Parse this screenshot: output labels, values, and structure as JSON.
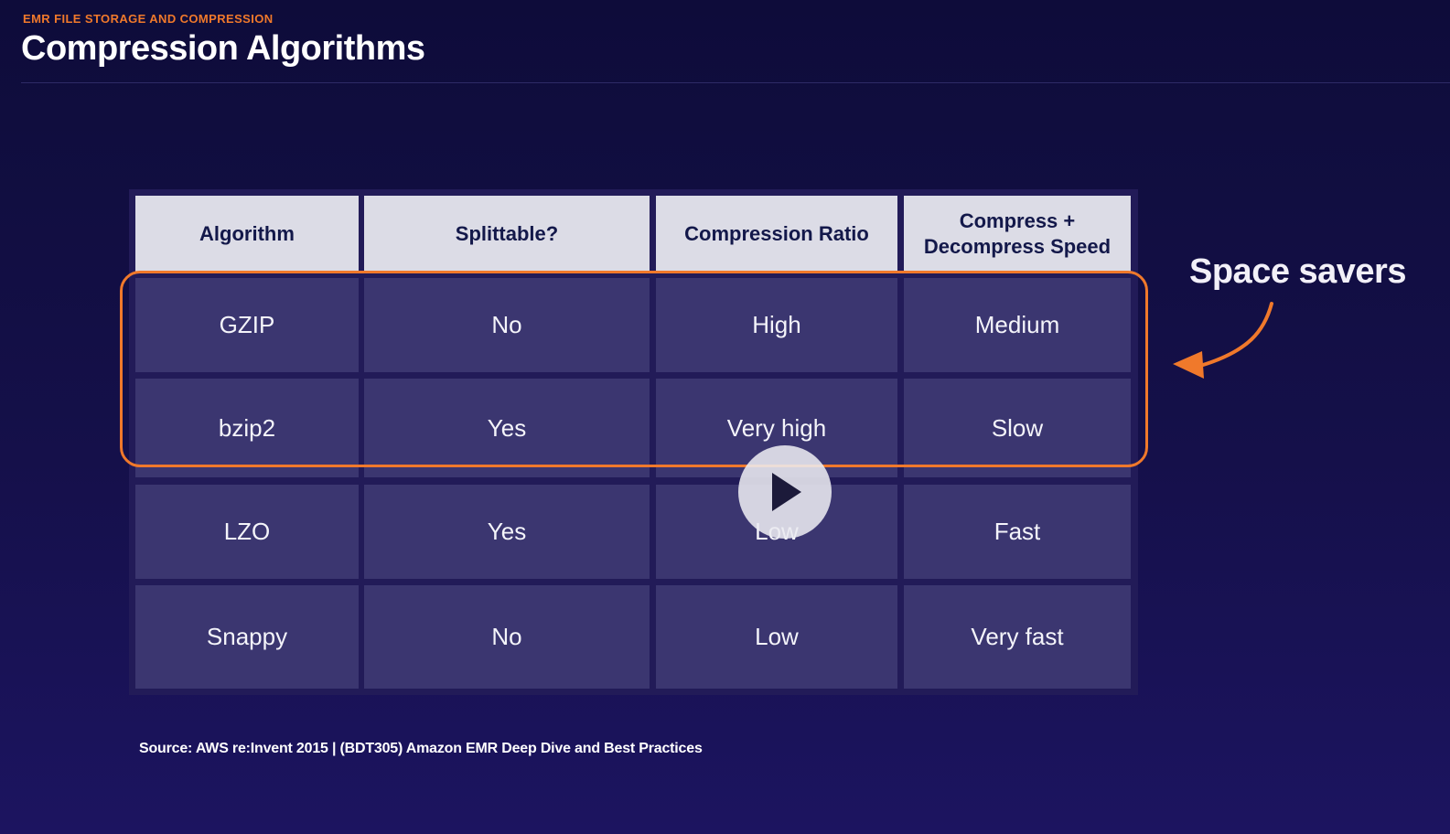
{
  "slide": {
    "eyebrow": "EMR FILE STORAGE AND COMPRESSION",
    "title": "Compression Algorithms",
    "callout": "Space savers",
    "source": "Source: AWS re:Invent 2015 | (BDT305) Amazon EMR Deep Dive and Best Practices"
  },
  "table": {
    "headers": [
      "Algorithm",
      "Splittable?",
      "Compression Ratio",
      "Compress +\nDecompress Speed"
    ],
    "rows": [
      [
        "GZIP",
        "No",
        "High",
        "Medium"
      ],
      [
        "bzip2",
        "Yes",
        "Very high",
        "Slow"
      ],
      [
        "LZO",
        "Yes",
        "Low",
        "Fast"
      ],
      [
        "Snappy",
        "No",
        "Low",
        "Very fast"
      ]
    ]
  },
  "colors": {
    "accent": "#f0792b",
    "header_bg": "#dcdce6",
    "cell_bg": "#3b3670",
    "background": "#15104a"
  },
  "icons": {
    "video_control": "play-icon",
    "callout_pointer": "curved-arrow-icon"
  }
}
